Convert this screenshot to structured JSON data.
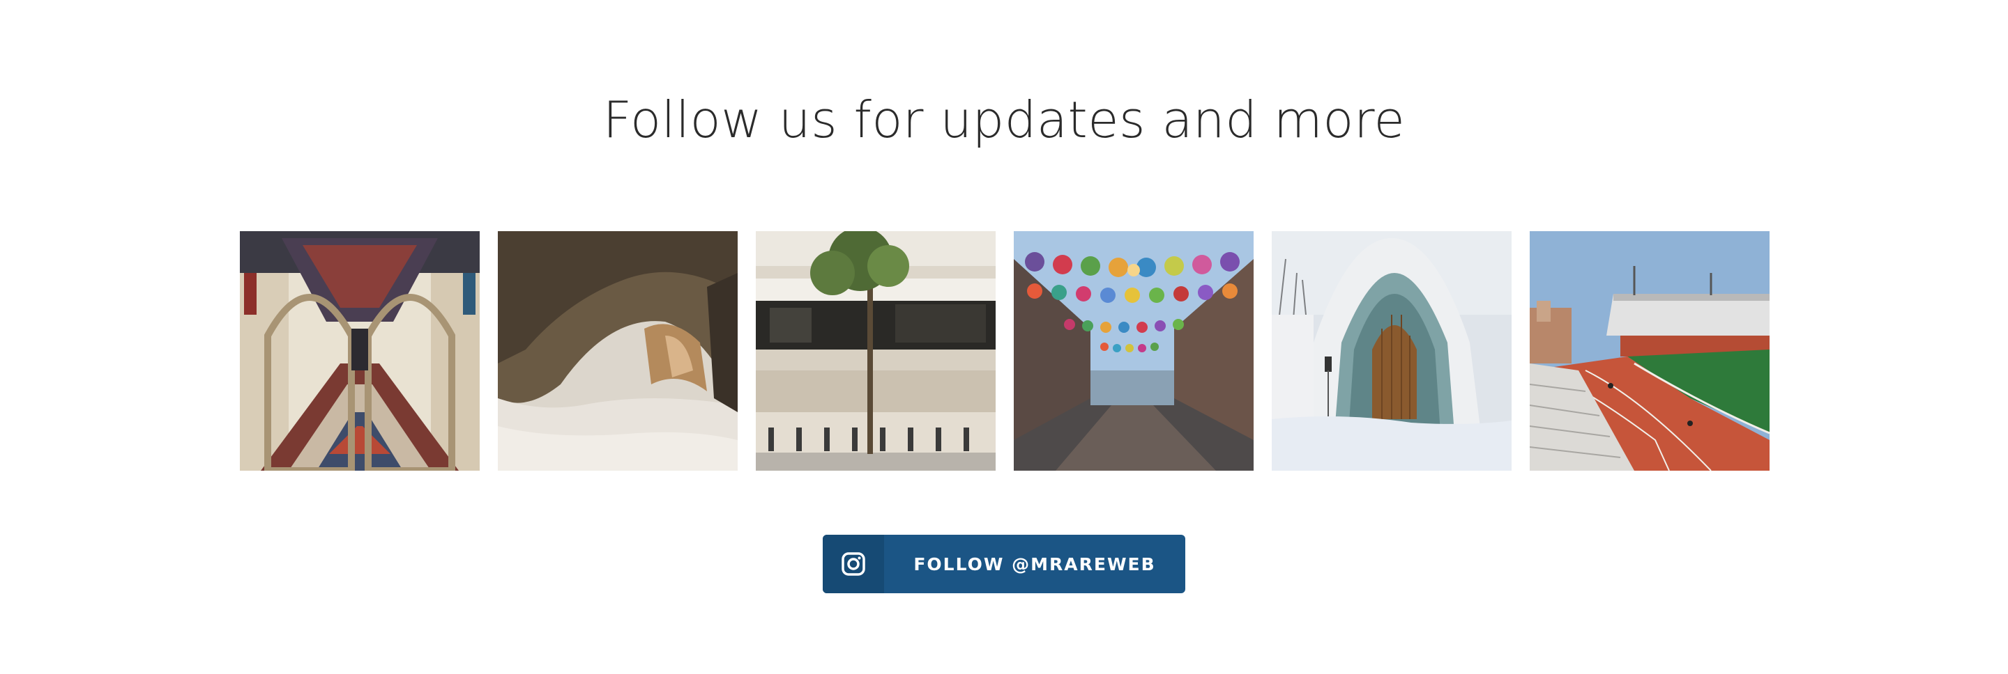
{
  "section": {
    "title": "Follow us for updates and more"
  },
  "gallery": {
    "photos": [
      {
        "icon": "photo-arched-corridor"
      },
      {
        "icon": "photo-rock-cave"
      },
      {
        "icon": "photo-building-street"
      },
      {
        "icon": "photo-lantern-street"
      },
      {
        "icon": "photo-ice-hotel-door"
      },
      {
        "icon": "photo-stadium-track"
      }
    ]
  },
  "follow_button": {
    "label": "FOLLOW @MRAREWEB",
    "icon": "instagram-icon",
    "color": "#1b5585"
  }
}
